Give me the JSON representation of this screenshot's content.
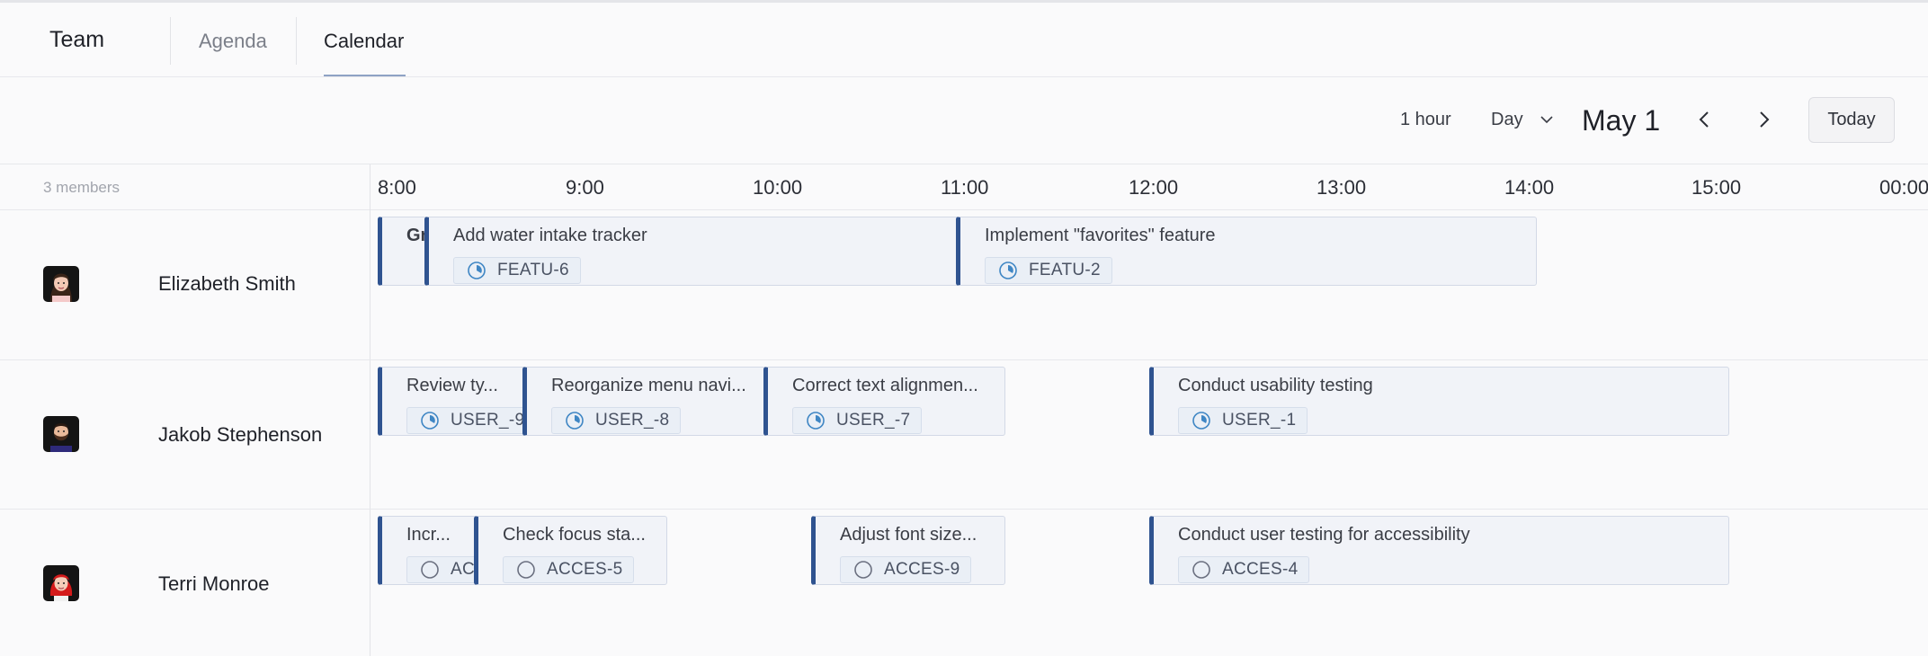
{
  "header": {
    "title": "Team",
    "tabs": [
      {
        "label": "Agenda",
        "active": false
      },
      {
        "label": "Calendar",
        "active": true
      }
    ]
  },
  "toolbar": {
    "interval": "1 hour",
    "view": "Day",
    "date": "May 1",
    "today_label": "Today"
  },
  "timeline": {
    "members_count": "3 members",
    "ticks": [
      "8:00",
      "9:00",
      "10:00",
      "11:00",
      "12:00",
      "13:00",
      "14:00",
      "15:00",
      "00:00"
    ]
  },
  "members": [
    {
      "name": "Elizabeth Smith",
      "avatar": "woman-dark-hair-avatar",
      "events": [
        {
          "title": "Gr",
          "key": "",
          "status": "in-progress",
          "bold": true
        },
        {
          "title": "Add water intake tracker",
          "key": "FEATU-6",
          "status": "in-progress"
        },
        {
          "title": "Implement \"favorites\" feature",
          "key": "FEATU-2",
          "status": "in-progress"
        }
      ]
    },
    {
      "name": "Jakob Stephenson",
      "avatar": "man-beard-avatar",
      "events": [
        {
          "title": "Review ty...",
          "key": "USER_-9",
          "status": "in-progress"
        },
        {
          "title": "Reorganize menu navi...",
          "key": "USER_-8",
          "status": "in-progress"
        },
        {
          "title": "Correct text alignmen...",
          "key": "USER_-7",
          "status": "in-progress"
        },
        {
          "title": "Conduct usability testing",
          "key": "USER_-1",
          "status": "in-progress"
        }
      ]
    },
    {
      "name": "Terri Monroe",
      "avatar": "woman-red-hair-avatar",
      "events": [
        {
          "title": "Incr...",
          "key": "AC",
          "status": "todo"
        },
        {
          "title": "Check focus sta...",
          "key": "ACCES-5",
          "status": "todo"
        },
        {
          "title": "Adjust font size...",
          "key": "ACCES-9",
          "status": "todo"
        },
        {
          "title": "Conduct user testing for accessibility",
          "key": "ACCES-4",
          "status": "todo"
        }
      ]
    }
  ],
  "colors": {
    "accent": "#2f5390",
    "event_bg": "#f1f3f8",
    "status_icon": "#3f86c4",
    "status_todo": "#6b7080"
  }
}
